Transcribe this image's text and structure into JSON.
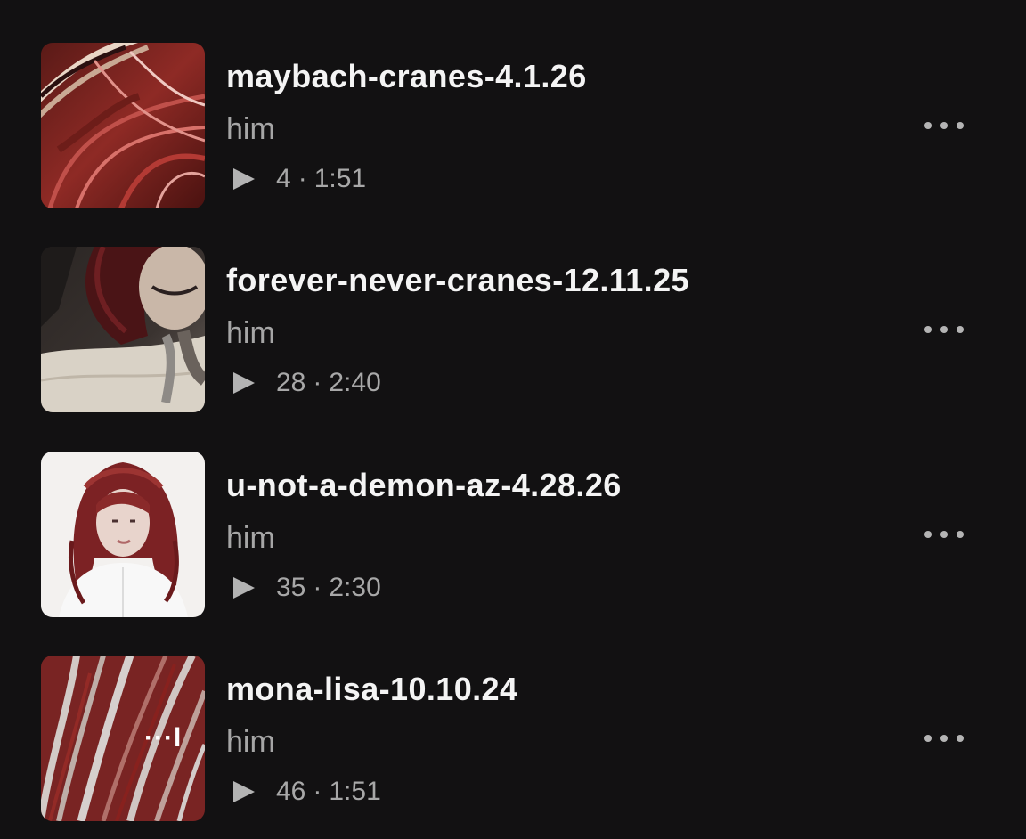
{
  "tracks": [
    {
      "title": "maybach-cranes-4.1.26",
      "artist": "him",
      "plays": "4",
      "separator": "·",
      "duration": "1:51",
      "artwork": "red-hair-closeup-artwork"
    },
    {
      "title": "forever-never-cranes-12.11.25",
      "artist": "him",
      "plays": "28",
      "separator": "·",
      "duration": "2:40",
      "artwork": "portrait-chain-bracelet-artwork"
    },
    {
      "title": "u-not-a-demon-az-4.28.26",
      "artist": "him",
      "plays": "35",
      "separator": "·",
      "duration": "2:30",
      "artwork": "red-hair-portrait-artwork"
    },
    {
      "title": "mona-lisa-10.10.24",
      "artist": "him",
      "plays": "46",
      "separator": "·",
      "duration": "1:51",
      "artwork": "red-white-strands-artwork",
      "now_playing_glyph": "···l"
    }
  ],
  "colors": {
    "background": "#121112",
    "title": "#f4f4f4",
    "secondary_text": "#a6a6a6",
    "icon": "#b4b4b4"
  },
  "icons": {
    "play": "play-icon",
    "more": "more-dots-icon",
    "now_playing": "now-playing-icon"
  }
}
